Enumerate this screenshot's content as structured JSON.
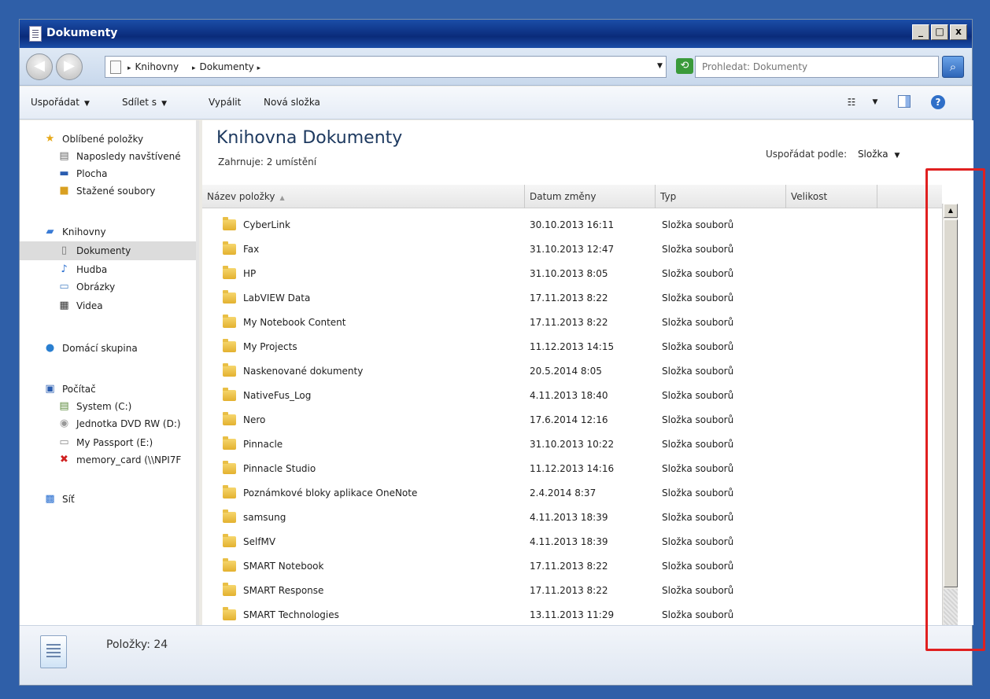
{
  "window": {
    "title": "Dokumenty",
    "minimize": "_",
    "maximize": "□",
    "close": "x"
  },
  "address": {
    "crumbs": [
      "Knihovny",
      "Dokumenty"
    ],
    "search_placeholder": "Prohledat: Dokumenty"
  },
  "toolbar": {
    "organize": "Uspořádat",
    "share": "Sdílet s",
    "burn": "Vypálit",
    "new_folder": "Nová složka"
  },
  "nav": {
    "favorites": "Oblíbené položky",
    "recent": "Naposledy navštívené",
    "desktop": "Plocha",
    "downloads": "Stažené soubory",
    "libraries": "Knihovny",
    "documents": "Dokumenty",
    "music": "Hudba",
    "pictures": "Obrázky",
    "videos": "Videa",
    "homegroup": "Domácí skupina",
    "computer": "Počítač",
    "drive_c": "System (C:)",
    "drive_d": "Jednotka DVD RW (D:)",
    "drive_e": "My Passport (E:)",
    "memory_card": "memory_card (\\\\NPI7F",
    "network": "Síť"
  },
  "library": {
    "title": "Knihovna Dokumenty",
    "subtitle": "Zahrnuje: 2 umístění",
    "arrange_label": "Uspořádat podle:",
    "arrange_value": "Složka"
  },
  "columns": {
    "name": "Název položky",
    "date": "Datum změny",
    "type": "Typ",
    "size": "Velikost"
  },
  "rows": [
    {
      "name": "CyberLink",
      "date": "30.10.2013 16:11",
      "type": "Složka souborů"
    },
    {
      "name": "Fax",
      "date": "31.10.2013 12:47",
      "type": "Složka souborů"
    },
    {
      "name": "HP",
      "date": "31.10.2013 8:05",
      "type": "Složka souborů"
    },
    {
      "name": "LabVIEW Data",
      "date": "17.11.2013 8:22",
      "type": "Složka souborů"
    },
    {
      "name": "My Notebook Content",
      "date": "17.11.2013 8:22",
      "type": "Složka souborů"
    },
    {
      "name": "My Projects",
      "date": "11.12.2013 14:15",
      "type": "Složka souborů"
    },
    {
      "name": "Naskenované dokumenty",
      "date": "20.5.2014 8:05",
      "type": "Složka souborů"
    },
    {
      "name": "NativeFus_Log",
      "date": "4.11.2013 18:40",
      "type": "Složka souborů"
    },
    {
      "name": "Nero",
      "date": "17.6.2014 12:16",
      "type": "Složka souborů"
    },
    {
      "name": "Pinnacle",
      "date": "31.10.2013 10:22",
      "type": "Složka souborů"
    },
    {
      "name": "Pinnacle Studio",
      "date": "11.12.2013 14:16",
      "type": "Složka souborů"
    },
    {
      "name": "Poznámkové bloky aplikace OneNote",
      "date": "2.4.2014 8:37",
      "type": "Složka souborů"
    },
    {
      "name": "samsung",
      "date": "4.11.2013 18:39",
      "type": "Složka souborů"
    },
    {
      "name": "SelfMV",
      "date": "4.11.2013 18:39",
      "type": "Složka souborů"
    },
    {
      "name": "SMART Notebook",
      "date": "17.11.2013 8:22",
      "type": "Složka souborů"
    },
    {
      "name": "SMART Response",
      "date": "17.11.2013 8:22",
      "type": "Složka souborů"
    },
    {
      "name": "SMART Technologies",
      "date": "13.11.2013 11:29",
      "type": "Složka souborů"
    }
  ],
  "status": {
    "items": "Položky: 24"
  },
  "colors": {
    "highlight": "#e02020",
    "titlebar": "#0a2b7a"
  }
}
